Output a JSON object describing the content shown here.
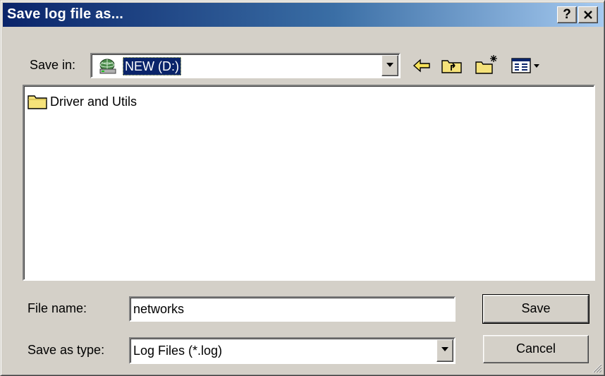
{
  "window": {
    "title": "Save log file as...",
    "help_label": "?",
    "close_label": "✕"
  },
  "save_in": {
    "label": "Save in:",
    "value": "NEW (D:)",
    "icon": "network-drive-icon"
  },
  "toolbar": {
    "back_icon": "back-arrow-icon",
    "up_icon": "up-folder-icon",
    "new_folder_icon": "new-folder-icon",
    "view_icon": "view-menu-icon"
  },
  "file_list": {
    "items": [
      {
        "name": "Driver and Utils",
        "icon": "folder-icon"
      }
    ]
  },
  "file_name": {
    "label": "File name:",
    "value": "networks"
  },
  "save_type": {
    "label": "Save as type:",
    "value": "Log Files (*.log)"
  },
  "buttons": {
    "save": "Save",
    "cancel": "Cancel"
  },
  "colors": {
    "title_start": "#0a246a",
    "title_end": "#a6caf0",
    "face": "#d4d0c8",
    "selection": "#0a246a"
  }
}
